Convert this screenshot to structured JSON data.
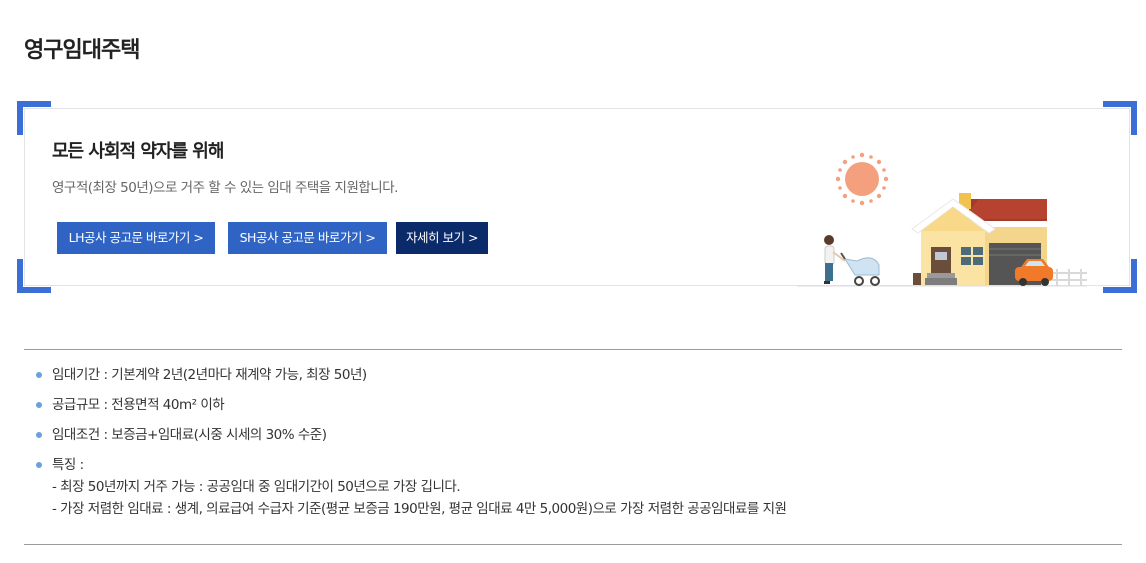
{
  "page": {
    "title": "영구임대주택"
  },
  "banner": {
    "heading": "모든 사회적 약자를 위해",
    "description": "영구적(최장 50년)으로 거주 할 수 있는 임대 주택을 지원합니다.",
    "buttons": {
      "lh": "LH공사 공고문 바로가기 >",
      "sh": "SH공사 공고문 바로가기 >",
      "more": "자세히 보기 >"
    },
    "colors": {
      "accent": "#3c6fd6",
      "button": "#2f64c4",
      "button_dark": "#0b2a6a"
    }
  },
  "info": {
    "items": [
      "임대기간 : 기본계약 2년(2년마다 재계약 가능, 최장 50년)",
      "공급규모 : 전용면적 40m² 이하",
      "임대조건 : 보증금+임대료(시중 시세의 30% 수준)",
      "특징 :"
    ],
    "features": [
      "- 최장 50년까지 거주 가능 : 공공임대 중 임대기간이 50년으로 가장 깁니다.",
      "- 가장 저렴한 임대료 : 생계, 의료급여 수급자 기준(평균 보증금 190만원, 평균 임대료 4만 5,000원)으로 가장 저렴한 공공임대료를 지원"
    ]
  }
}
